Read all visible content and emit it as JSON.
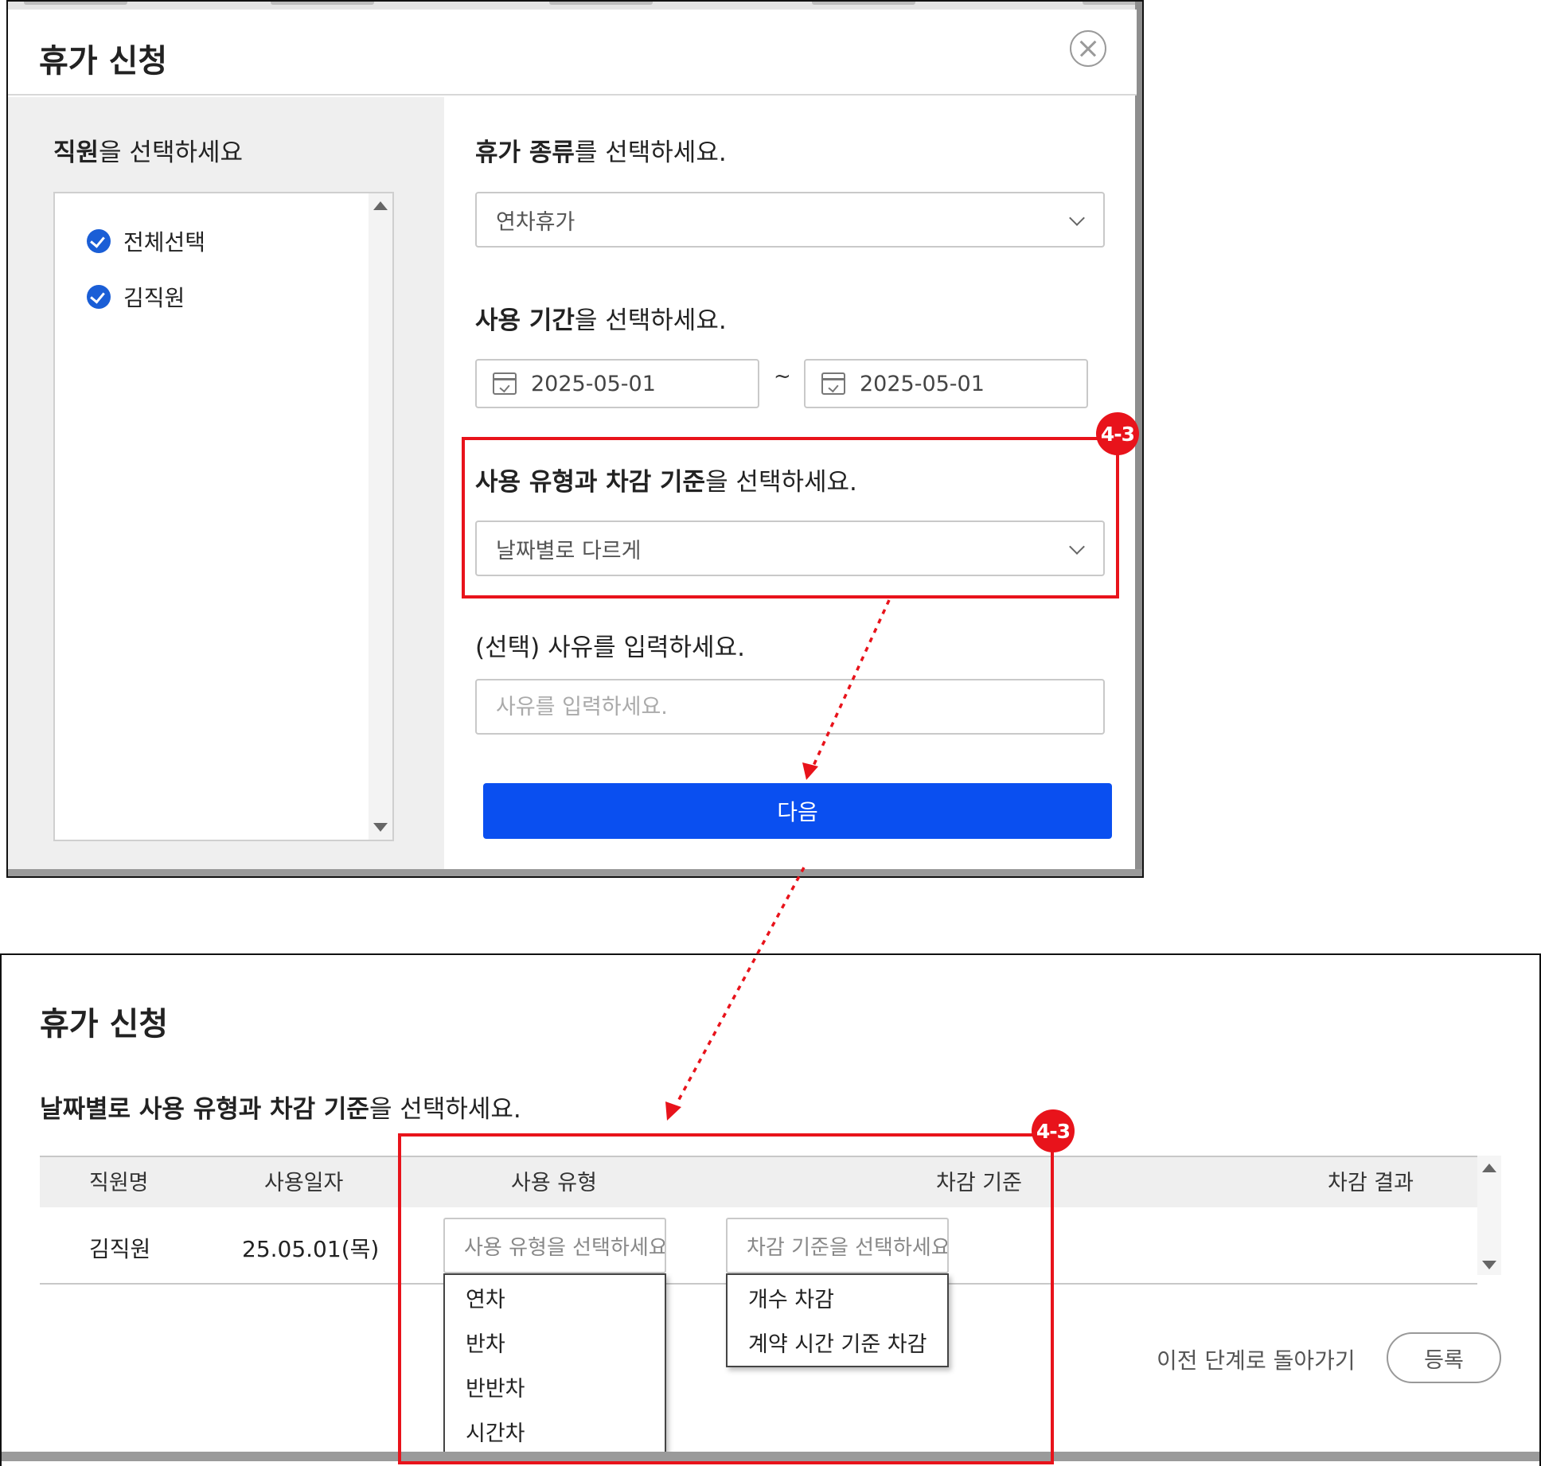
{
  "modal1": {
    "title": "휴가 신청",
    "employee_heading_bold": "직원",
    "employee_heading_rest": "을 선택하세요",
    "employees": [
      {
        "label": "전체선택",
        "checked": true
      },
      {
        "label": "김직원",
        "checked": true
      }
    ],
    "leave_type": {
      "heading_bold": "휴가 종류",
      "heading_rest": "를 선택하세요.",
      "selected": "연차휴가"
    },
    "period": {
      "heading_bold": "사용 기간",
      "heading_rest": "을 선택하세요.",
      "start_date": "2025-05-01",
      "separator": "~",
      "end_date": "2025-05-01"
    },
    "usage_type": {
      "heading_bold": "사용 유형과 차감 기준",
      "heading_rest": "을 선택하세요.",
      "selected": "날짜별로 다르게"
    },
    "reason": {
      "heading": "(선택) 사유를 입력하세요.",
      "placeholder": "사유를 입력하세요.",
      "value": ""
    },
    "next_button": "다음"
  },
  "annotation": {
    "badge_label": "4-3",
    "color": "#e8131b"
  },
  "modal2": {
    "title": "휴가 신청",
    "subtitle_bold": "날짜별로 사용 유형과 차감 기준",
    "subtitle_rest": "을 선택하세요.",
    "table": {
      "columns": [
        "직원명",
        "사용일자",
        "사용 유형",
        "차감 기준",
        "차감 결과"
      ],
      "rows": [
        {
          "employee": "김직원",
          "date": "25.05.01(목)",
          "usage_type_placeholder": "사용 유형을 선택하세요",
          "deduction_placeholder": "차감 기준을 선택하세요",
          "result": ""
        }
      ]
    },
    "usage_type_options": [
      "연차",
      "반차",
      "반반차",
      "시간차"
    ],
    "deduction_options": [
      "개수 차감",
      "계약 시간 기준 차감"
    ],
    "back_link": "이전 단계로 돌아가기",
    "register_button": "등록"
  },
  "colors": {
    "primary_blue": "#0a4ff0",
    "check_blue": "#1a5ed6",
    "annotation_red": "#e8131b"
  }
}
